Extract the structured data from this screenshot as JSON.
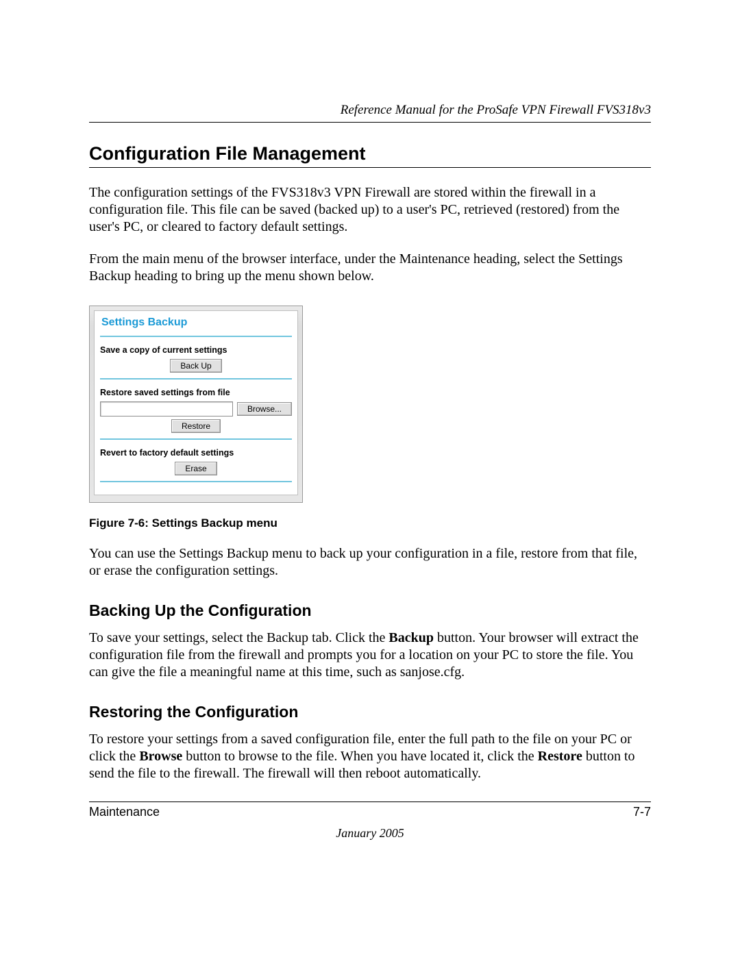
{
  "header": {
    "running": "Reference Manual for the ProSafe VPN Firewall FVS318v3"
  },
  "section": {
    "heading": "Configuration File Management",
    "para1": "The configuration settings of the FVS318v3 VPN Firewall are stored within the firewall in a configuration file. This file can be saved (backed up) to a user's PC, retrieved (restored) from the user's PC, or cleared to factory default settings.",
    "para2": "From the main menu of the browser interface, under the Maintenance heading, select the Settings Backup heading to bring up the menu shown below."
  },
  "panel": {
    "title": "Settings Backup",
    "save_label": "Save a copy of current settings",
    "backup_btn": "Back Up",
    "restore_label": "Restore saved settings from file",
    "browse_btn": "Browse...",
    "restore_btn": "Restore",
    "revert_label": "Revert to factory default settings",
    "erase_btn": "Erase",
    "file_value": ""
  },
  "figure": {
    "caption": "Figure 7-6:  Settings Backup menu"
  },
  "after_figure": {
    "para": "You can use the Settings Backup menu to back up your configuration in a file, restore from that file, or erase the configuration settings."
  },
  "sub1": {
    "heading": "Backing Up the Configuration",
    "para_a": "To save your settings, select the Backup tab. Click the ",
    "bold1": "Backup",
    "para_b": " button. Your browser will extract the configuration file from the firewall and prompts you for a location on your PC to store the file. You can give the file a meaningful name at this time, such as sanjose.cfg."
  },
  "sub2": {
    "heading": "Restoring the Configuration",
    "para_a": "To restore your settings from a saved configuration file, enter the full path to the file on your PC or click the ",
    "bold1": "Browse",
    "para_b": " button to browse to the file. When you have located it, click the ",
    "bold2": "Restore",
    "para_c": " button to send the file to the firewall. The firewall will then reboot automatically."
  },
  "footer": {
    "left": "Maintenance",
    "right": "7-7",
    "date": "January 2005"
  }
}
